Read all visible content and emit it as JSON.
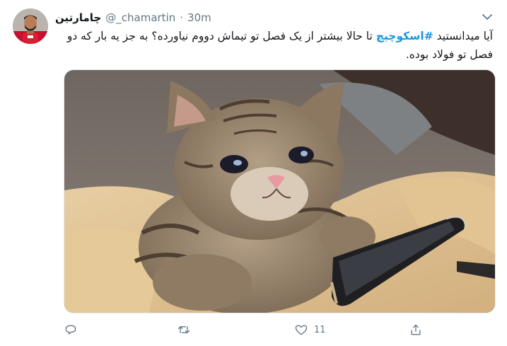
{
  "tweet": {
    "author_name": "چامارتین",
    "handle": "@_chamartin",
    "separator": "·",
    "time": "30m",
    "text_prefix": "آیا میدانستید ",
    "hashtag": "#اسکوچیچ",
    "text_suffix": " تا حالا بیشتر از یک فصل تو تیماش دووم نیاورده؟ به جز یه بار که دو فصل تو فولاد بوده."
  },
  "actions": {
    "reply_count": "",
    "retweet_count": "",
    "like_count": "11",
    "share_count": ""
  },
  "colors": {
    "accent": "#1b95e0",
    "text": "#14171a",
    "muted": "#657786"
  },
  "icons": [
    "user-avatar",
    "chevron-down-icon",
    "reply-icon",
    "retweet-icon",
    "like-icon",
    "share-icon"
  ]
}
